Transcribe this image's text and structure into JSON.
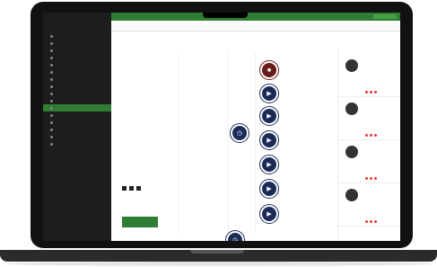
{
  "device": {
    "type": "laptop-mockup"
  },
  "sidebar": {
    "items": [
      {
        "label": "",
        "active": false
      },
      {
        "label": "",
        "active": false
      },
      {
        "label": "",
        "active": false
      },
      {
        "label": "",
        "active": false
      },
      {
        "label": "",
        "active": false
      },
      {
        "label": "",
        "active": false
      },
      {
        "label": "",
        "active": false
      },
      {
        "label": "",
        "active": false
      },
      {
        "label": "",
        "active": false
      },
      {
        "label": "",
        "active": false
      },
      {
        "label": "",
        "active": true
      },
      {
        "label": "",
        "active": false
      },
      {
        "label": "",
        "active": false
      },
      {
        "label": "",
        "active": false
      },
      {
        "label": "",
        "active": false
      },
      {
        "label": "",
        "active": false
      }
    ]
  },
  "canvas": {
    "start_node": {
      "icon": "stop-icon"
    },
    "step_nodes": [
      {
        "icon": "play-icon"
      },
      {
        "icon": "play-icon"
      },
      {
        "icon": "play-icon"
      },
      {
        "icon": "play-icon"
      },
      {
        "icon": "play-icon"
      },
      {
        "icon": "play-icon"
      },
      {
        "icon": "clock-icon"
      },
      {
        "icon": "clock-icon"
      }
    ]
  },
  "panel": {
    "cards": [
      {
        "has_status": true
      },
      {
        "has_status": false
      },
      {
        "has_status": true
      },
      {
        "has_status": true
      }
    ]
  },
  "colors": {
    "brand_green": "#2e7d32",
    "node_navy": "#1b2b57",
    "start_maroon": "#6a1b1b",
    "alert_red": "#c0392b"
  }
}
